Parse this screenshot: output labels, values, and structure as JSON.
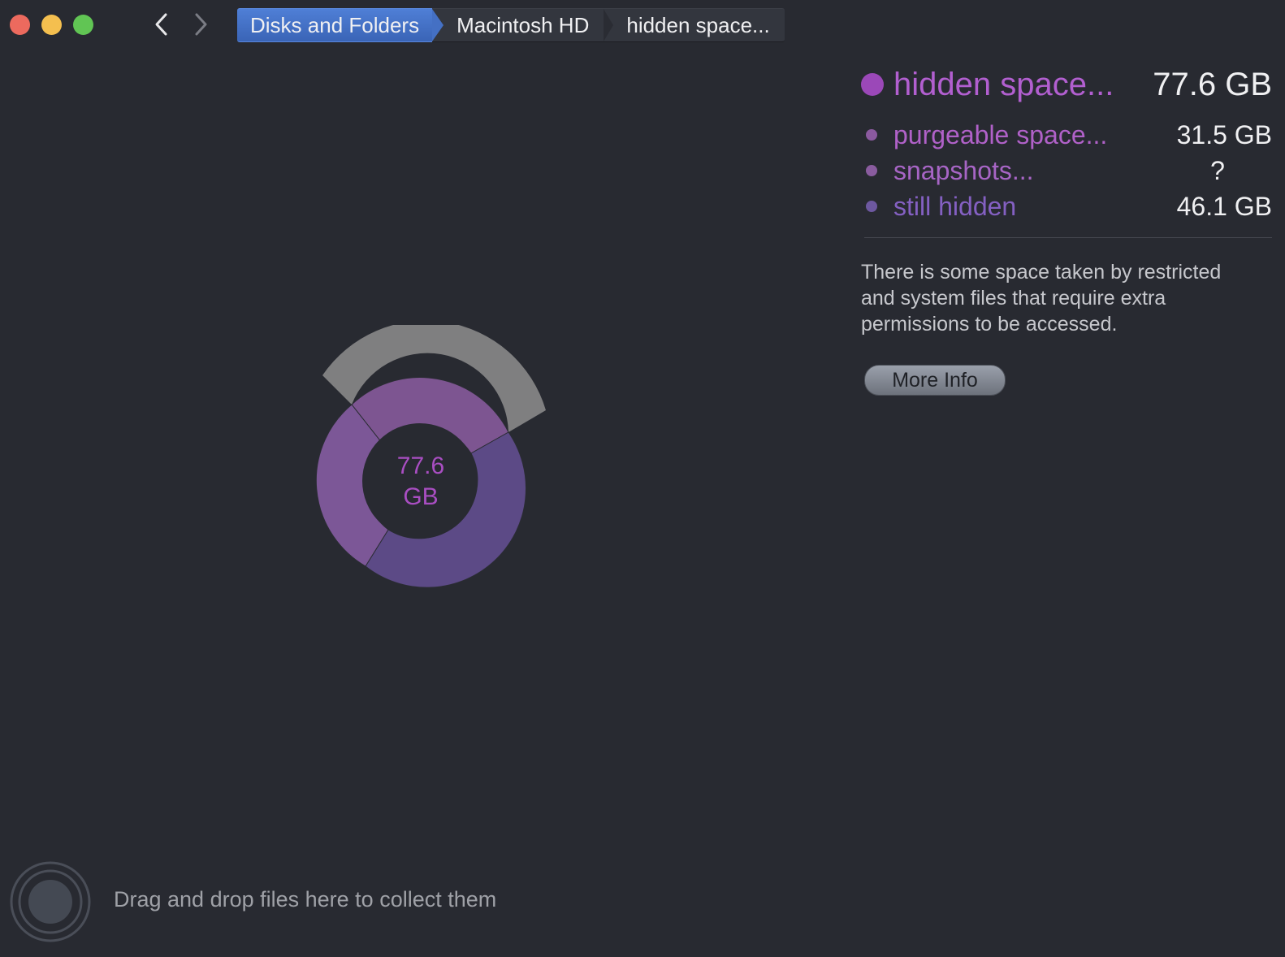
{
  "window": {
    "controls": [
      "close",
      "minimize",
      "zoom"
    ]
  },
  "nav": {
    "back_icon": "chevron-left-icon",
    "forward_icon": "chevron-right-icon"
  },
  "breadcrumb": {
    "items": [
      {
        "label": "Disks and Folders"
      },
      {
        "label": "Macintosh HD"
      },
      {
        "label": "hidden space..."
      }
    ]
  },
  "chart_data": {
    "type": "pie",
    "center_value": "77.6",
    "center_unit": "GB",
    "slices": [
      {
        "label": "purgeable space...",
        "value": 31.5,
        "color": "#7d5591"
      },
      {
        "label": "snapshots...",
        "value": null,
        "color": "#7c5797"
      },
      {
        "label": "still hidden",
        "value": 46.1,
        "color": "#5c4a86"
      }
    ],
    "outer_ring": {
      "color": "#7f7f80"
    }
  },
  "legend": {
    "header": {
      "name": "hidden space...",
      "size": "77.6 GB",
      "color": "#9b48b8"
    },
    "items": [
      {
        "name": "purgeable space...",
        "size": "31.5 GB",
        "color": "#b061c8",
        "dot": "#8b5a9f"
      },
      {
        "name": "snapshots...",
        "size": "?",
        "color": "#a765c5",
        "dot": "#8a5c9f"
      },
      {
        "name": "still hidden",
        "size": "46.1 GB",
        "color": "#8460c2",
        "dot": "#6d58a0"
      }
    ]
  },
  "info": {
    "description": "There is some space taken by restricted and system files that require extra permissions to be accessed.",
    "more_info_label": "More Info"
  },
  "dropzone": {
    "text": "Drag and drop files here to collect them"
  }
}
